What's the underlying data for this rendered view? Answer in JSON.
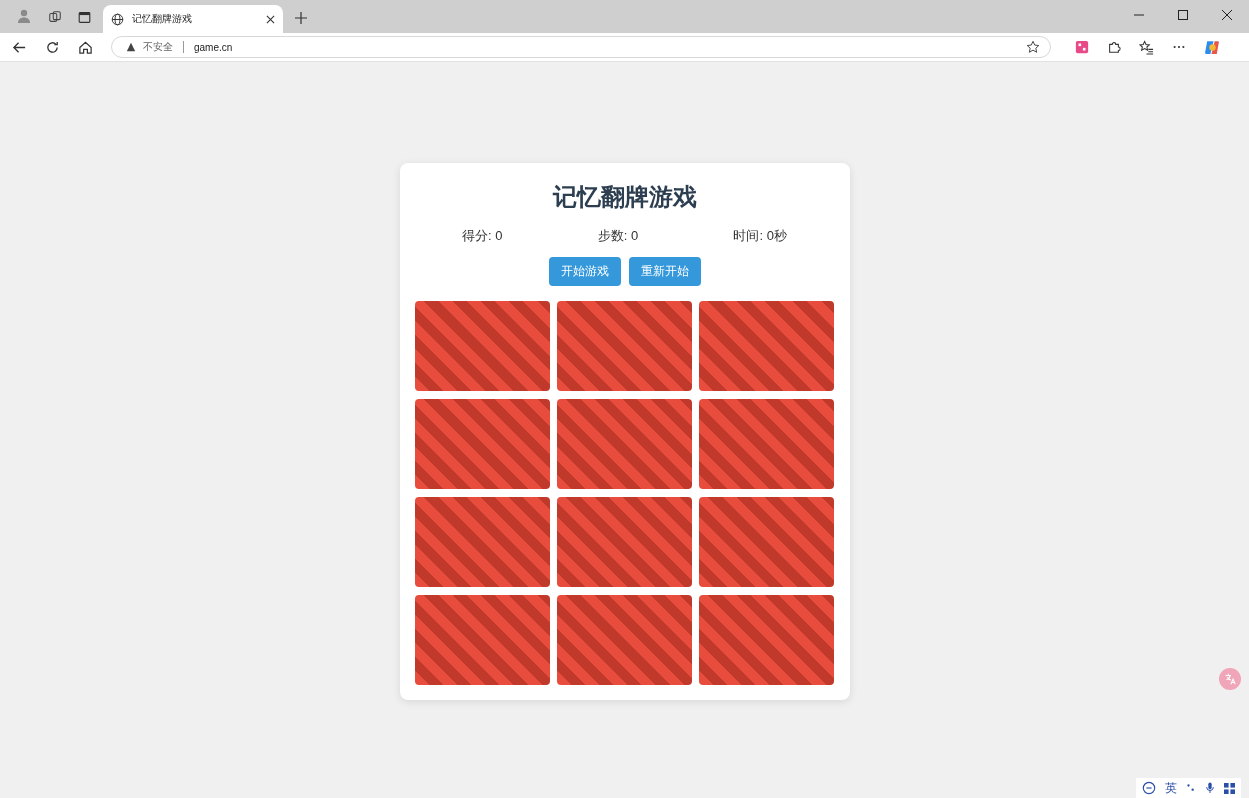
{
  "browser": {
    "tab_title": "记忆翻牌游戏",
    "security_label": "不安全",
    "url": "game.cn"
  },
  "game": {
    "title": "记忆翻牌游戏",
    "stats": [
      "得分: 0",
      "步数: 0",
      "时间: 0秒"
    ],
    "buttons": [
      "开始游戏",
      "重新开始"
    ],
    "cards": [
      {
        "flipped": false
      },
      {
        "flipped": false
      },
      {
        "flipped": false
      },
      {
        "flipped": false
      },
      {
        "flipped": false
      },
      {
        "flipped": false
      },
      {
        "flipped": false
      },
      {
        "flipped": false
      },
      {
        "flipped": false
      },
      {
        "flipped": false
      },
      {
        "flipped": false
      },
      {
        "flipped": false
      }
    ]
  },
  "ime_toolbar": {
    "language": "英"
  }
}
